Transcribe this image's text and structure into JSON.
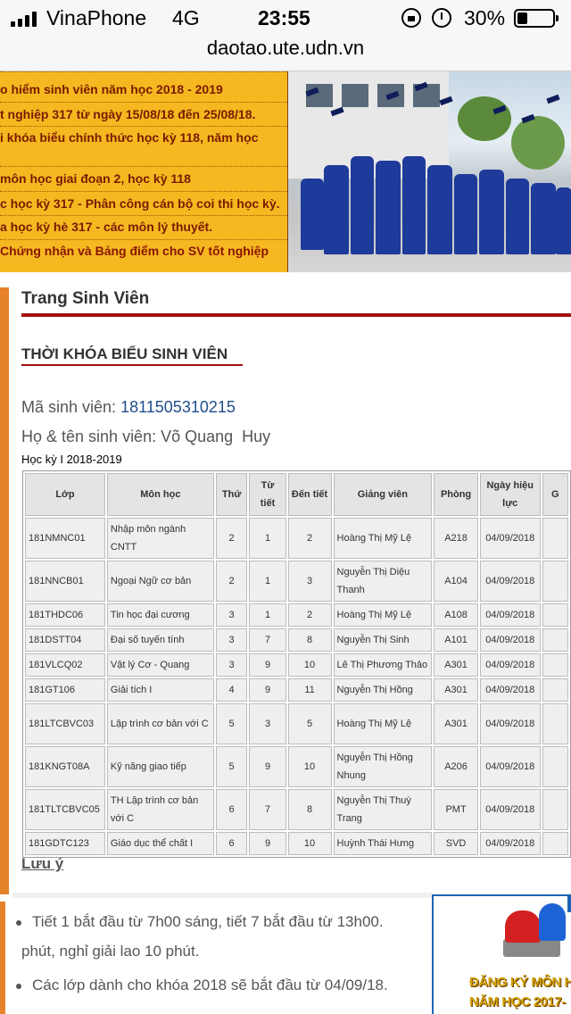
{
  "status_bar": {
    "carrier": "VinaPhone",
    "network": "4G",
    "time": "23:55",
    "battery_percent": "30%",
    "battery_level": 0.3,
    "icons": [
      "signal-icon",
      "lock-rotation-icon",
      "alarm-icon",
      "battery-icon"
    ]
  },
  "browser": {
    "url": "daotao.ute.udn.vn"
  },
  "news": [
    "o hiểm sinh viên năm học 2018 - 2019",
    "t nghiệp 317 từ ngày 15/08/18 đến 25/08/18.",
    "i khóa biểu chính thức học kỳ 118, năm học",
    "môn học giai đoạn 2, học kỳ 118",
    "c học kỳ 317 - Phân công cán bộ coi thi học kỳ.",
    "a học kỳ hè 317 - các môn lý thuyết.",
    "Chứng nhận và Bảng điểm cho SV tốt nghiệp"
  ],
  "section_title": "Trang Sinh Viên",
  "page_title": "THỜI KHÓA BIỂU SINH VIÊN",
  "student": {
    "id_label": "Mã sinh viên:",
    "id_value": "1811505310215",
    "name_label": "Họ & tên sinh viên:",
    "name_value": "Võ Quang  Huy"
  },
  "semester": "Học kỳ I 2018-2019",
  "table": {
    "headers": [
      "Lớp",
      "Môn học",
      "Thứ",
      "Từ tiết",
      "Đến tiết",
      "Giảng viên",
      "Phòng",
      "Ngày hiệu lực",
      "G"
    ],
    "rows": [
      [
        "181NMNC01",
        "Nhập môn ngành CNTT",
        "2",
        "1",
        "2",
        "Hoàng Thị Mỹ Lệ",
        "A218",
        "04/09/2018"
      ],
      [
        "181NNCB01",
        "Ngoại Ngữ cơ bản",
        "2",
        "1",
        "3",
        "Nguyễn Thị Diệu Thanh",
        "A104",
        "04/09/2018"
      ],
      [
        "181THDC06",
        "Tin học đại cương",
        "3",
        "1",
        "2",
        "Hoàng Thị Mỹ Lệ",
        "A108",
        "04/09/2018"
      ],
      [
        "181DSTT04",
        "Đại số tuyến tính",
        "3",
        "7",
        "8",
        "Nguyễn Thị Sinh",
        "A101",
        "04/09/2018"
      ],
      [
        "181VLCQ02",
        "Vật lý Cơ - Quang",
        "3",
        "9",
        "10",
        "Lê Thị Phương Thảo",
        "A301",
        "04/09/2018"
      ],
      [
        "181GT106",
        "Giải tích I",
        "4",
        "9",
        "11",
        "Nguyễn Thị Hồng",
        "A301",
        "04/09/2018"
      ],
      [
        "181LTCBVC03",
        "Lập trình cơ bản với C",
        "5",
        "3",
        "5",
        "Hoàng Thị Mỹ Lệ",
        "A301",
        "04/09/2018"
      ],
      [
        "181KNGT08A",
        "Kỹ năng giao tiếp",
        "5",
        "9",
        "10",
        "Nguyễn Thị Hồng Nhung",
        "A206",
        "04/09/2018"
      ],
      [
        "181TLTCBVC05",
        "TH Lập trình cơ bản với C",
        "6",
        "7",
        "8",
        "Nguyễn Thị Thuỳ Trang",
        "PMT",
        "04/09/2018"
      ],
      [
        "181GDTC123",
        "Giáo dục thể chất I",
        "6",
        "9",
        "10",
        "Huỳnh Thái Hưng",
        "SVD",
        "04/09/2018"
      ]
    ]
  },
  "notes": {
    "title": "Lưu ý",
    "items": [
      "Tiết 1 bắt đầu từ 7h00 sáng, tiết 7 bắt đầu từ 13h00.",
      "phút, nghỉ giải lao 10 phút.",
      "Các lớp dành cho khóa 2018 sẽ bắt đầu từ 04/09/18."
    ]
  },
  "banner": {
    "line1": "ĐĂNG KÝ MÔN HỌ",
    "line2": "NĂM HỌC 2017-"
  },
  "colors": {
    "accent_red": "#a01010",
    "news_bg": "#f5b820",
    "rail": "#e6822a",
    "link": "#1f4e8a"
  }
}
